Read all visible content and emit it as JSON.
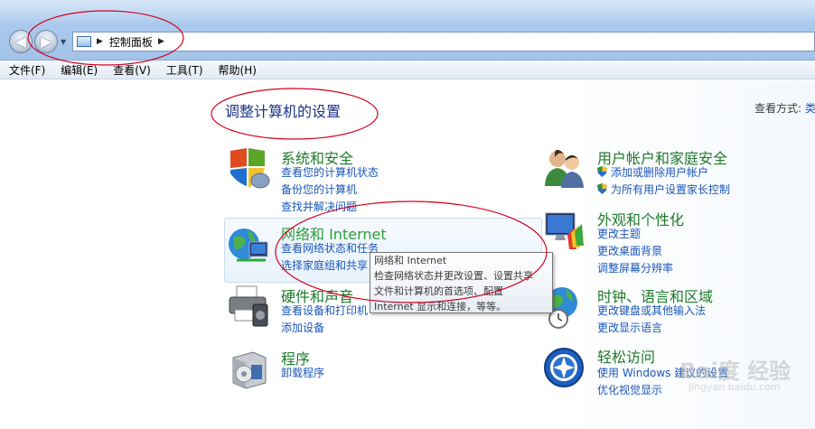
{
  "address": {
    "segment": "控制面板"
  },
  "menu": [
    "文件(F)",
    "编辑(E)",
    "查看(V)",
    "工具(T)",
    "帮助(H)"
  ],
  "content": {
    "title": "调整计算机的设置",
    "view_by_label": "查看方式:",
    "view_by_value": "类"
  },
  "categories": [
    {
      "title": "系统和安全",
      "links": [
        "查看您的计算机状态",
        "备份您的计算机",
        "查找并解决问题"
      ],
      "icon": "shield-flag-icon"
    },
    {
      "title": "网络和 Internet",
      "links": [
        "查看网络状态和任务",
        "选择家庭组和共享"
      ],
      "icon": "globe-network-icon"
    },
    {
      "title": "硬件和声音",
      "links": [
        "查看设备和打印机",
        "添加设备"
      ],
      "icon": "printer-icon"
    },
    {
      "title": "程序",
      "links": [
        "卸载程序"
      ],
      "icon": "programs-box-icon"
    },
    {
      "title": "用户帐户和家庭安全",
      "links": [
        "添加或删除用户帐户",
        "为所有用户设置家长控制"
      ],
      "icon": "users-icon"
    },
    {
      "title": "外观和个性化",
      "links": [
        "更改主题",
        "更改桌面背景",
        "调整屏幕分辨率"
      ],
      "icon": "monitor-palette-icon"
    },
    {
      "title": "时钟、语言和区域",
      "links": [
        "更改键盘或其他输入法",
        "更改显示语言"
      ],
      "icon": "clock-globe-icon"
    },
    {
      "title": "轻松访问",
      "links": [
        "使用 Windows 建议的设置",
        "优化视觉显示"
      ],
      "icon": "ease-of-access-icon"
    }
  ],
  "tooltip": {
    "lines": [
      "网络和 Internet",
      "检查网络状态并更改设置、设置共享",
      "文件和计算机的首选项、配置",
      "Internet 显示和连接，等等。"
    ]
  },
  "watermark": {
    "text": "Bai度 经验",
    "sub": "jingyan.baidu.com"
  },
  "colors": {
    "category_title": "#1d7a2a",
    "link": "#1a56b8",
    "page_title": "#1e3287",
    "annotation": "#d3001f"
  }
}
